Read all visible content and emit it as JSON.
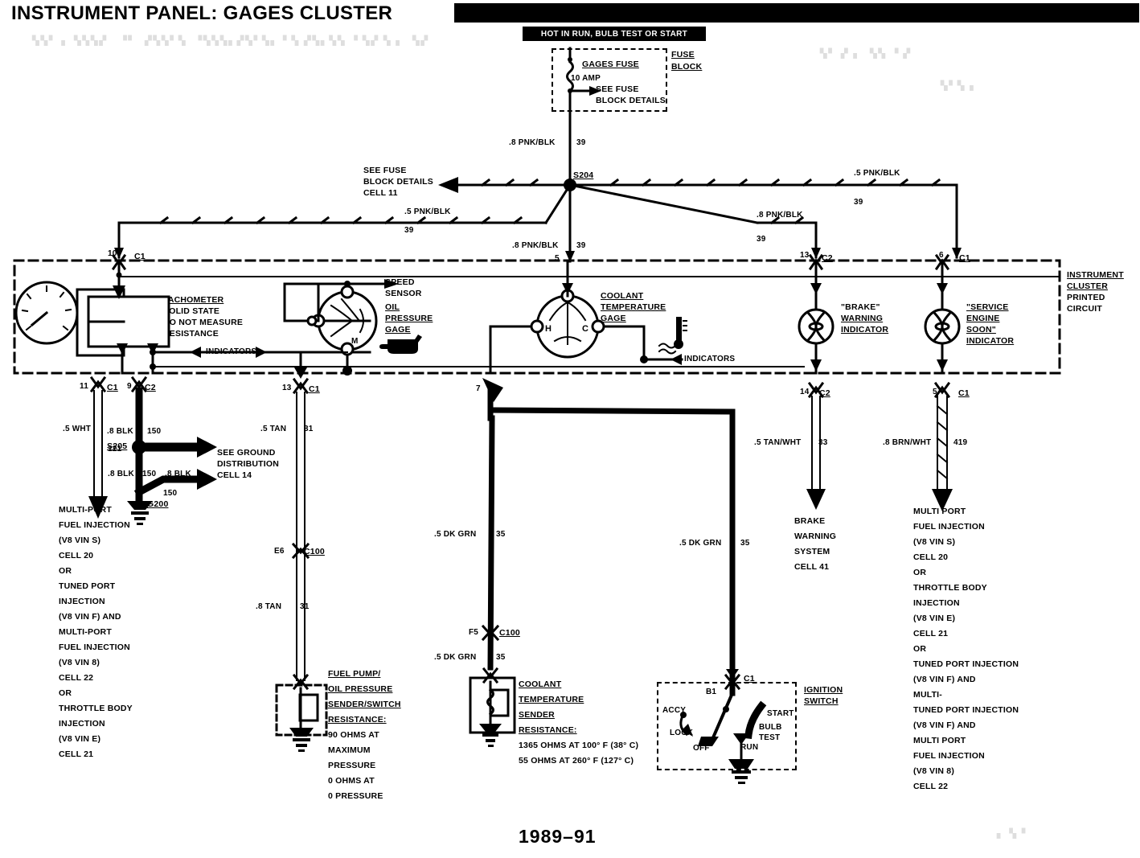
{
  "header": {
    "title": "INSTRUMENT PANEL: GAGES CLUSTER",
    "year": "1989–91"
  },
  "fuse_block": {
    "hot_label": "HOT IN RUN, BULB TEST OR START",
    "block_title_line1": "FUSE",
    "block_title_line2": "BLOCK",
    "fuse_name": "GAGES FUSE",
    "fuse_rating": "10 AMP",
    "see_line1": "SEE FUSE",
    "see_line2": "BLOCK DETAILS"
  },
  "splices": {
    "s204": "S204",
    "s205": "S205",
    "g200": "G200"
  },
  "refs": {
    "see_fuse_block": [
      "SEE FUSE",
      "BLOCK DETAILS",
      "CELL 11"
    ],
    "see_ground": [
      "SEE GROUND",
      "DISTRIBUTION",
      "CELL 14"
    ],
    "brake_warning_system": [
      "BRAKE",
      "WARNING",
      "SYSTEM",
      "CELL 41"
    ]
  },
  "wires": {
    "fuse_to_s204": {
      "size_color": ".8 PNK/BLK",
      "circuit": "39"
    },
    "s204_left": {
      "size_color": ".5 PNK/BLK",
      "circuit": "39"
    },
    "s204_down": {
      "size_color": ".8 PNK/BLK",
      "circuit": "39"
    },
    "s204_right_low": {
      "size_color": ".8 PNK/BLK",
      "circuit": "39"
    },
    "s204_right_high": {
      "size_color": ".5 PNK/BLK",
      "circuit": "39"
    },
    "tach_wht": {
      "size_color": ".5 WHT",
      "circuit": "121"
    },
    "blk_upper": {
      "size_color": ".8 BLK",
      "circuit": "150"
    },
    "blk_lower": {
      "size_color": ".8 BLK",
      "circuit": "150"
    },
    "blk_branch": {
      "size_color": ".8 BLK",
      "circuit": "150"
    },
    "tan_upper": {
      "size_color": ".5 TAN",
      "circuit": "31"
    },
    "tan_lower": {
      "size_color": ".8 TAN",
      "circuit": "31"
    },
    "dkgrn_left": {
      "size_color": ".5 DK GRN",
      "circuit": "35"
    },
    "dkgrn_lower": {
      "size_color": ".5 DK GRN",
      "circuit": "35"
    },
    "dkgrn_right": {
      "size_color": ".5 DK GRN",
      "circuit": "35"
    },
    "tan_wht": {
      "size_color": ".5 TAN/WHT",
      "circuit": "33"
    },
    "brn_wht": {
      "size_color": ".8 BRN/WHT",
      "circuit": "419"
    }
  },
  "connectors": {
    "top_c1_tach": {
      "pin": "10",
      "name": "C1"
    },
    "top_c2_brake": {
      "pin": "13",
      "name": "C2"
    },
    "top_c1_ses": {
      "pin": "6",
      "name": "C1"
    },
    "bottom_c1_11": {
      "pin": "11",
      "name": "C1"
    },
    "bottom_c2_9": {
      "pin": "9",
      "name": "C2"
    },
    "bottom_c1_13": {
      "pin": "13",
      "name": "C1"
    },
    "bottom_pin7": {
      "pin": "7",
      "name": ""
    },
    "bottom_c2_14": {
      "pin": "14",
      "name": "C2"
    },
    "bottom_c1_5": {
      "pin": "5",
      "name": "C1"
    },
    "c100_e6": {
      "pin": "E6",
      "name": "C100"
    },
    "c100_f5": {
      "pin": "F5",
      "name": "C100"
    },
    "ign_c1": {
      "pin": "",
      "name": "C1"
    },
    "ign_pin": "B1",
    "s204_down_pin": "5"
  },
  "cluster": {
    "edge_label": [
      "INSTRUMENT",
      "CLUSTER",
      "PRINTED",
      "CIRCUIT"
    ],
    "tachometer": [
      "TACHOMETER",
      "SOLID STATE",
      "DO NOT MEASURE",
      "RESISTANCE"
    ],
    "speed_sensor": [
      "SPEED",
      "SENSOR"
    ],
    "oil_pressure_gage": [
      "OIL",
      "PRESSURE",
      "GAGE"
    ],
    "coolant_temp_gage": [
      "COOLANT",
      "TEMPERATURE",
      "GAGE"
    ],
    "coolant_terminals": {
      "hot": "H",
      "cold": "C"
    },
    "oil_terminal": "M",
    "brake_indicator": [
      "\"BRAKE\"",
      "WARNING",
      "INDICATOR"
    ],
    "ses_indicator": [
      "\"SERVICE",
      "ENGINE",
      "SOON\"",
      "INDICATOR"
    ],
    "indicators_left": "INDICATORS",
    "indicators_right": "INDICATORS"
  },
  "senders": {
    "fuel_pump_oil": {
      "lines": [
        "FUEL PUMP/",
        "OIL PRESSURE",
        "SENDER/SWITCH",
        "RESISTANCE:",
        "90 OHMS AT",
        "MAXIMUM",
        "PRESSURE",
        "0 OHMS AT",
        "0 PRESSURE"
      ]
    },
    "coolant": {
      "lines": [
        "COOLANT",
        "TEMPERATURE",
        "SENDER",
        "RESISTANCE:",
        "1365 OHMS AT 100° F (38° C)",
        "55 OHMS AT 260° F (127° C)"
      ]
    }
  },
  "ignition_switch": {
    "title_line1": "IGNITION",
    "title_line2": "SWITCH",
    "positions": [
      "ACCY",
      "LOCK",
      "OFF",
      "RUN",
      "BULB",
      "TEST",
      "START"
    ]
  },
  "destinations": {
    "left_block": [
      "MULTI-PORT",
      "FUEL INJECTION",
      "(V8 VIN S)",
      "CELL 20",
      "OR",
      "TUNED PORT",
      "INJECTION",
      "(V8 VIN F) AND",
      "MULTI-PORT",
      "FUEL INJECTION",
      "(V8 VIN 8)",
      "CELL 22",
      "OR",
      "THROTTLE BODY",
      "INJECTION",
      "(V8 VIN E)",
      "CELL 21"
    ],
    "right_block": [
      "MULTI PORT",
      "FUEL INJECTION",
      "(V8 VIN S)",
      "CELL 20",
      "OR",
      "THROTTLE BODY",
      "INJECTION",
      "(V8 VIN E)",
      "CELL 21",
      "OR",
      "TUNED PORT INJECTION",
      "(V8 VIN F) AND",
      "MULTI-",
      "TUNED PORT INJECTION",
      "(V8 VIN F) AND",
      "MULTI PORT",
      "FUEL INJECTION",
      "(V8 VIN 8)",
      "CELL 22"
    ]
  },
  "colors": {
    "ink": "#000000",
    "paper": "#ffffff"
  }
}
